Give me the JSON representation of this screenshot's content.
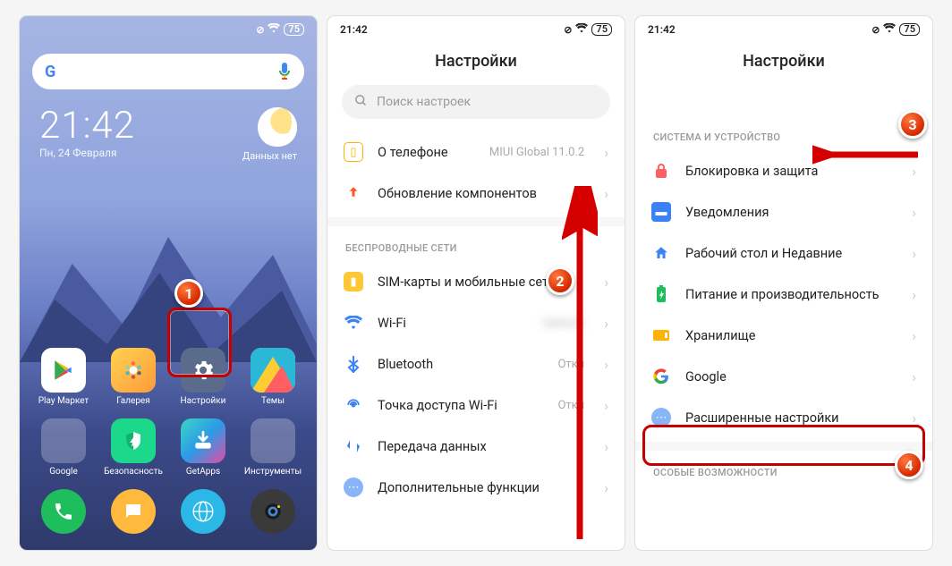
{
  "status": {
    "time": "21:42",
    "battery": "75"
  },
  "home": {
    "date": "Пн, 24 Февраля",
    "weather": "Данных нет",
    "apps": {
      "play": "Play Маркет",
      "gallery": "Галерея",
      "settings": "Настройки",
      "themes": "Темы",
      "google": "Google",
      "security": "Безопасность",
      "getapps": "GetApps",
      "tools": "Инструменты"
    }
  },
  "settings1": {
    "title": "Настройки",
    "search_placeholder": "Поиск настроек",
    "about_label": "О телефоне",
    "about_value": "MIUI Global 11.0.2",
    "update_label": "Обновление компонентов",
    "section_wireless": "БЕСПРОВОДНЫЕ СЕТИ",
    "sim": "SIM-карты и мобильные сети",
    "wifi": "Wi-Fi",
    "bt": "Bluetooth",
    "bt_val": "Откл",
    "hotspot": "Точка доступа Wi-Fi",
    "hotspot_val": "Откл",
    "data": "Передача данных",
    "more": "Дополнительные функции"
  },
  "settings2": {
    "title": "Настройки",
    "section_system": "СИСТЕМА И УСТРОЙСТВО",
    "lock": "Блокировка и защита",
    "notif": "Уведомления",
    "home": "Рабочий стол и Недавние",
    "battery": "Питание и производительность",
    "storage": "Хранилище",
    "google": "Google",
    "advanced": "Расширенные настройки",
    "section_special": "ОСОБЫЕ ВОЗМОЖНОСТИ"
  },
  "badges": {
    "b1": "1",
    "b2": "2",
    "b3": "3",
    "b4": "4"
  }
}
